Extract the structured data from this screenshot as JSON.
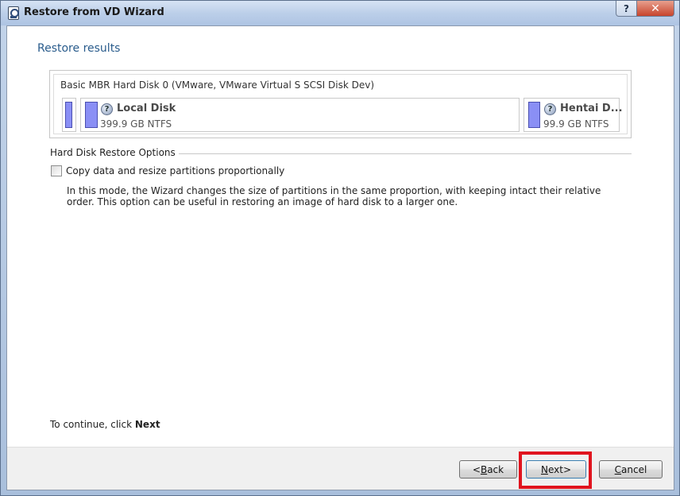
{
  "window": {
    "title": "Restore from VD Wizard",
    "help_label": "?",
    "close_label": "✕"
  },
  "page": {
    "title": "Restore results"
  },
  "disk": {
    "label": "Basic MBR Hard Disk 0 (VMware, VMware Virtual S SCSI Disk Dev)",
    "partitions": [
      {
        "name": "",
        "size": ""
      },
      {
        "name": "Local Disk",
        "size": "399.9 GB NTFS"
      },
      {
        "name": "Hentai D...",
        "size": "99.9 GB NTFS"
      }
    ],
    "partition_color": "#8a8ff5"
  },
  "options": {
    "group_title": "Hard Disk Restore Options",
    "checkbox_label": "Copy data and resize partitions proportionally",
    "checkbox_checked": false,
    "description": "In this mode, the Wizard changes the size of partitions in the same proportion, with keeping intact their relative order. This option can be useful in restoring an image of hard disk to a larger one."
  },
  "footer": {
    "continue_prefix": "To continue, click ",
    "continue_bold": "Next"
  },
  "buttons": {
    "back_arrow": "< ",
    "back_key": "B",
    "back_rest": "ack",
    "next_key": "N",
    "next_rest": "ext",
    "next_arrow": " >",
    "cancel_key": "C",
    "cancel_rest": "ancel"
  },
  "highlight_color": "#e0141e"
}
